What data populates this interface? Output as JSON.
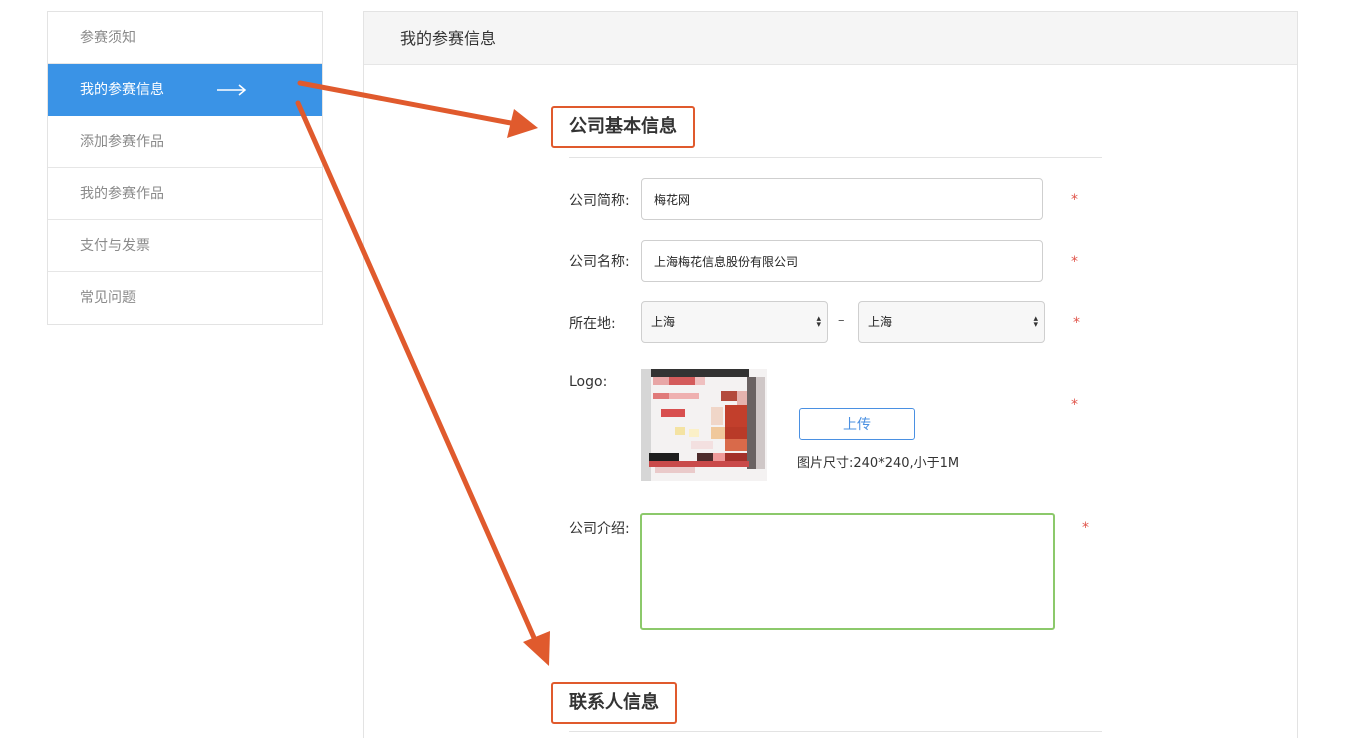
{
  "sidebar": {
    "items": [
      {
        "label": "参赛须知"
      },
      {
        "label": "我的参赛信息"
      },
      {
        "label": "添加参赛作品"
      },
      {
        "label": "我的参赛作品"
      },
      {
        "label": "支付与发票"
      },
      {
        "label": "常见问题"
      }
    ]
  },
  "main": {
    "header_title": "我的参赛信息",
    "section_company": {
      "title": "公司基本信息",
      "short_name_label": "公司简称:",
      "short_name_value": "梅花网",
      "full_name_label": "公司名称:",
      "full_name_value": "上海梅花信息股份有限公司",
      "location_label": "所在地:",
      "province_value": "上海",
      "location_separator": "–",
      "city_value": "上海",
      "logo_label": "Logo:",
      "upload_label": "上传",
      "upload_hint": "图片尺寸:240*240,小于1M",
      "intro_label": "公司介绍:",
      "required_mark": "*"
    },
    "section_contact": {
      "title": "联系人信息"
    }
  },
  "colors": {
    "active_tab": "#3a93e6",
    "annotation": "#e05a2d",
    "textarea_border": "#8cc96b",
    "upload_button": "#4a90e2",
    "required": "#e0544a"
  }
}
